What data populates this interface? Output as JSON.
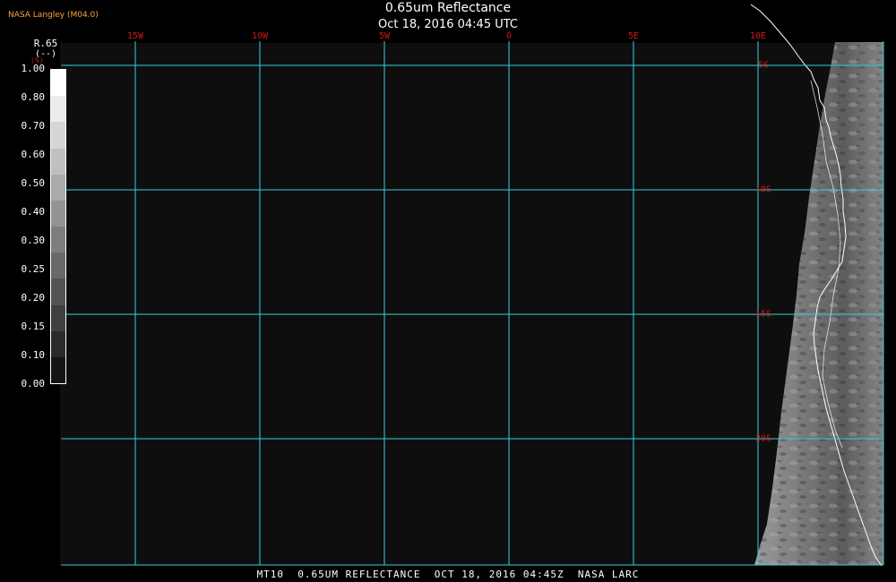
{
  "header": {
    "title": "0.65um Reflectance",
    "timestamp": "Oct 18, 2016 04:45 UTC",
    "credit": "NASA Langley (M04.0)"
  },
  "footer": {
    "caption": "MT10  0.65UM REFLECTANCE  OCT 18, 2016 04:45Z  NASA LARC"
  },
  "colorbar": {
    "variable": "R.65",
    "units": "(--)",
    "unit_symbol": "(%)",
    "labels": [
      "1.00",
      "0.80",
      "0.70",
      "0.60",
      "0.50",
      "0.40",
      "0.30",
      "0.25",
      "0.20",
      "0.15",
      "0.10",
      "0.00"
    ],
    "steps": [
      "#ffffff",
      "#ececec",
      "#d6d6d6",
      "#c0c0c0",
      "#aaaaaa",
      "#949494",
      "#7e7e7e",
      "#696969",
      "#545454",
      "#404040",
      "#2a2a2a",
      "#141414"
    ]
  },
  "grid": {
    "line_color": "#35d0e0",
    "label_color": "#d01818",
    "longitudes": [
      {
        "label": "15W",
        "value": -15
      },
      {
        "label": "10W",
        "value": -10
      },
      {
        "label": "5W",
        "value": -5
      },
      {
        "label": "0",
        "value": 0
      },
      {
        "label": "5E",
        "value": 5
      },
      {
        "label": "10E",
        "value": 10
      }
    ],
    "latitudes": [
      {
        "label": "5S",
        "value": -5
      },
      {
        "label": "10S",
        "value": -10
      },
      {
        "label": "15S",
        "value": -15
      },
      {
        "label": "20S",
        "value": -20
      }
    ]
  },
  "colors": {
    "background": "#000000",
    "ocean": "#0e0e0e",
    "coastline": "#ffffff",
    "credit_text": "#ffa040"
  }
}
